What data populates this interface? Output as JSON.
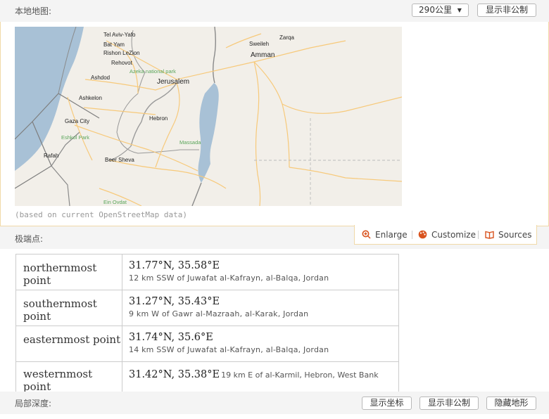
{
  "top_bar": {
    "label": "本地地图:",
    "distance_select": "290公里",
    "unofficial_button": "显示非公制"
  },
  "map": {
    "place_labels": {
      "tel_aviv": "Tel Aviv-Yafo",
      "bat_yam": "Bat Yam",
      "rishon": "Rishon LeZion",
      "rehovot": "Rehovot",
      "ashdod": "Ashdod",
      "ashkelon": "Ashkelon",
      "gaza": "Gaza City",
      "rafah": "Rafah",
      "beer_sheva": "Beer Sheva",
      "hebron": "Hebron",
      "jerusalem": "Jerusalem",
      "azeka": "Azeka national park",
      "eshkol": "Eshkol Park",
      "massada": "Massada",
      "ein_ovdat": "Ein Ovdat",
      "sweileh": "Sweileh",
      "zarqa": "Zarqa",
      "amman": "Amman"
    },
    "colors": {
      "water": "#a8c1d6",
      "land": "#f2efe9",
      "road": "#f7c97a",
      "border": "#8a8a8a"
    }
  },
  "map_caption": "(based on current OpenStreetMap data)",
  "extreme_bar": {
    "label": "极端点:"
  },
  "actions": {
    "enlarge": "Enlarge",
    "customize": "Customize",
    "sources": "Sources"
  },
  "extremes": [
    {
      "label": "northernmost point",
      "coord": "31.77°N, 35.58°E",
      "desc": "12 km SSW of Juwafat al-Kafrayn, al-Balqa, Jordan"
    },
    {
      "label": "southernmost point",
      "coord": "31.27°N, 35.43°E",
      "desc": "9 km W of Gawr al-Mazraah, al-Karak, Jordan"
    },
    {
      "label": "easternmost point",
      "coord": "31.74°N, 35.6°E",
      "desc": "14 km SSW of Juwafat al-Kafrayn, al-Balqa, Jordan"
    },
    {
      "label": "westernmost point",
      "coord": "31.42°N, 35.38°E",
      "desc": "19 km E of al-Karmil, Hebron, West Bank"
    }
  ],
  "bottom_bar": {
    "label": "局部深度:",
    "coords_button": "显示坐标",
    "unofficial_button": "显示非公制",
    "hide_terrain_button": "隐藏地形"
  }
}
